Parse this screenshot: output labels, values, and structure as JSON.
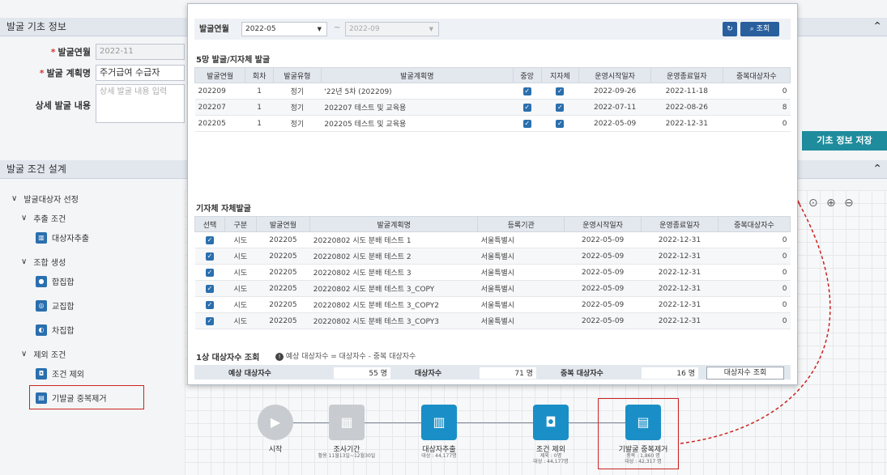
{
  "basic": {
    "section_title": "발굴 기초 정보",
    "label_year_month": "발굴연월",
    "value_year_month": "2022-11",
    "label_plan": "발굴 계획명",
    "value_plan": "주거급여 수급자",
    "label_detail": "상세 발굴 내용",
    "placeholder_detail": "상세 발굴 내용 입력",
    "save_button": "기초 정보 저장"
  },
  "condition": {
    "section_title": "발굴 조건 설계",
    "tree": {
      "root": "발굴대상자 선정",
      "extract_group": "추출 조건",
      "extract_item": "대상자추출",
      "combine_group": "조합 생성",
      "union": "합집합",
      "intersect": "교집합",
      "diff": "차집합",
      "exclude_group": "제외 조건",
      "cond_exclude": "조건 제외",
      "dedup": "기발굴 중복제거"
    }
  },
  "flow": {
    "nodes": [
      {
        "label": "시작",
        "sub1": "",
        "sub2": ""
      },
      {
        "label": "조사기간",
        "sub1": "활용 11월13일~12월30일",
        "sub2": ""
      },
      {
        "label": "대상자추출",
        "sub1": "대상 : 44,177명",
        "sub2": ""
      },
      {
        "label": "조건 제외",
        "sub1": "제외 : 0명",
        "sub2": "대상 : 44,177명"
      },
      {
        "label": "기발굴 중복제거",
        "sub1": "중복 : 1,860 명",
        "sub2": "대상 : 42,317 명"
      }
    ]
  },
  "popup": {
    "filter_label": "발굴연월",
    "from_value": "2022-05",
    "tilde": "~",
    "to_value": "2022-09",
    "search_button": "조회",
    "refresh_icon": "refresh-icon",
    "table1_title": "5망 발굴/지자체 발굴",
    "table1_headers": [
      "발굴연월",
      "회차",
      "발굴유형",
      "발굴계획명",
      "중앙",
      "지자체",
      "운영시작일자",
      "운영종료일자",
      "중복대상자수"
    ],
    "table1_rows": [
      [
        "202209",
        "1",
        "정기",
        "'22년 5차 (202209)",
        "2022-09-26",
        "2022-11-18",
        "0"
      ],
      [
        "202207",
        "1",
        "정기",
        "202207 테스트 및 교육용",
        "2022-07-11",
        "2022-08-26",
        "8"
      ],
      [
        "202205",
        "1",
        "정기",
        "202205 테스트 및 교육용",
        "2022-05-09",
        "2022-12-31",
        "0"
      ]
    ],
    "table2_title": "기자체 자체발굴",
    "table2_headers": [
      "선택",
      "구분",
      "발굴연월",
      "발굴계획명",
      "등록기관",
      "운영시작일자",
      "운영종료일자",
      "중복대상자수"
    ],
    "table2_rows": [
      [
        "시도",
        "202205",
        "20220802 시도 분배 테스트 1",
        "서울특별시",
        "2022-05-09",
        "2022-12-31",
        "0"
      ],
      [
        "시도",
        "202205",
        "20220802 시도 분배 테스트 2",
        "서울특별시",
        "2022-05-09",
        "2022-12-31",
        "0"
      ],
      [
        "시도",
        "202205",
        "20220802 시도 분배 테스트 3",
        "서울특별시",
        "2022-05-09",
        "2022-12-31",
        "0"
      ],
      [
        "시도",
        "202205",
        "20220802 시도 분배 테스트 3_COPY",
        "서울특별시",
        "2022-05-09",
        "2022-12-31",
        "0"
      ],
      [
        "시도",
        "202205",
        "20220802 시도 분배 테스트 3_COPY2",
        "서울특별시",
        "2022-05-09",
        "2022-12-31",
        "0"
      ],
      [
        "시도",
        "202205",
        "20220802 시도 분배 테스트 3_COPY3",
        "서울특별시",
        "2022-05-09",
        "2022-12-31",
        "0"
      ]
    ],
    "summary_title": "1상 대상자수 조회",
    "summary_note": "예상 대상자수 = 대상자수 - 중복 대상자수",
    "summary_labels": [
      "예상 대상자수",
      "대상자수",
      "중복 대상자수"
    ],
    "summary_values": [
      "55 명",
      "71 명",
      "16 명"
    ],
    "summary_button": "대상자수 조회"
  },
  "colors": {
    "accent": "#2a6fae",
    "node": "#1a8fc7",
    "highlight": "#cc2222",
    "save": "#1e8c9c"
  }
}
